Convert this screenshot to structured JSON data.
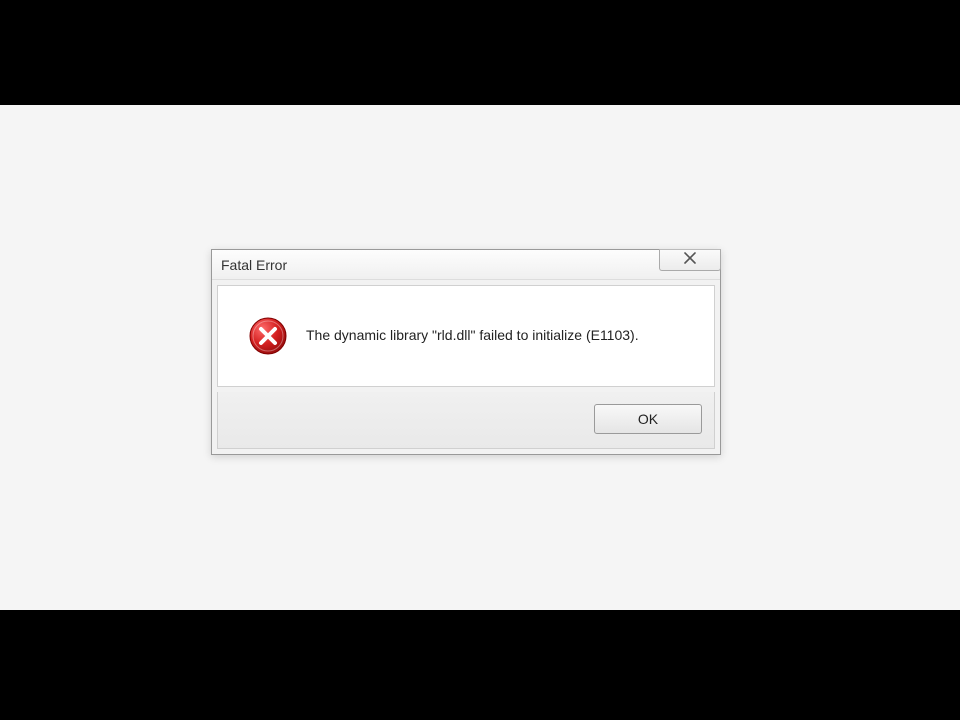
{
  "dialog": {
    "title": "Fatal Error",
    "message": "The dynamic library \"rld.dll\" failed to initialize (E1103).",
    "ok_label": "OK"
  }
}
